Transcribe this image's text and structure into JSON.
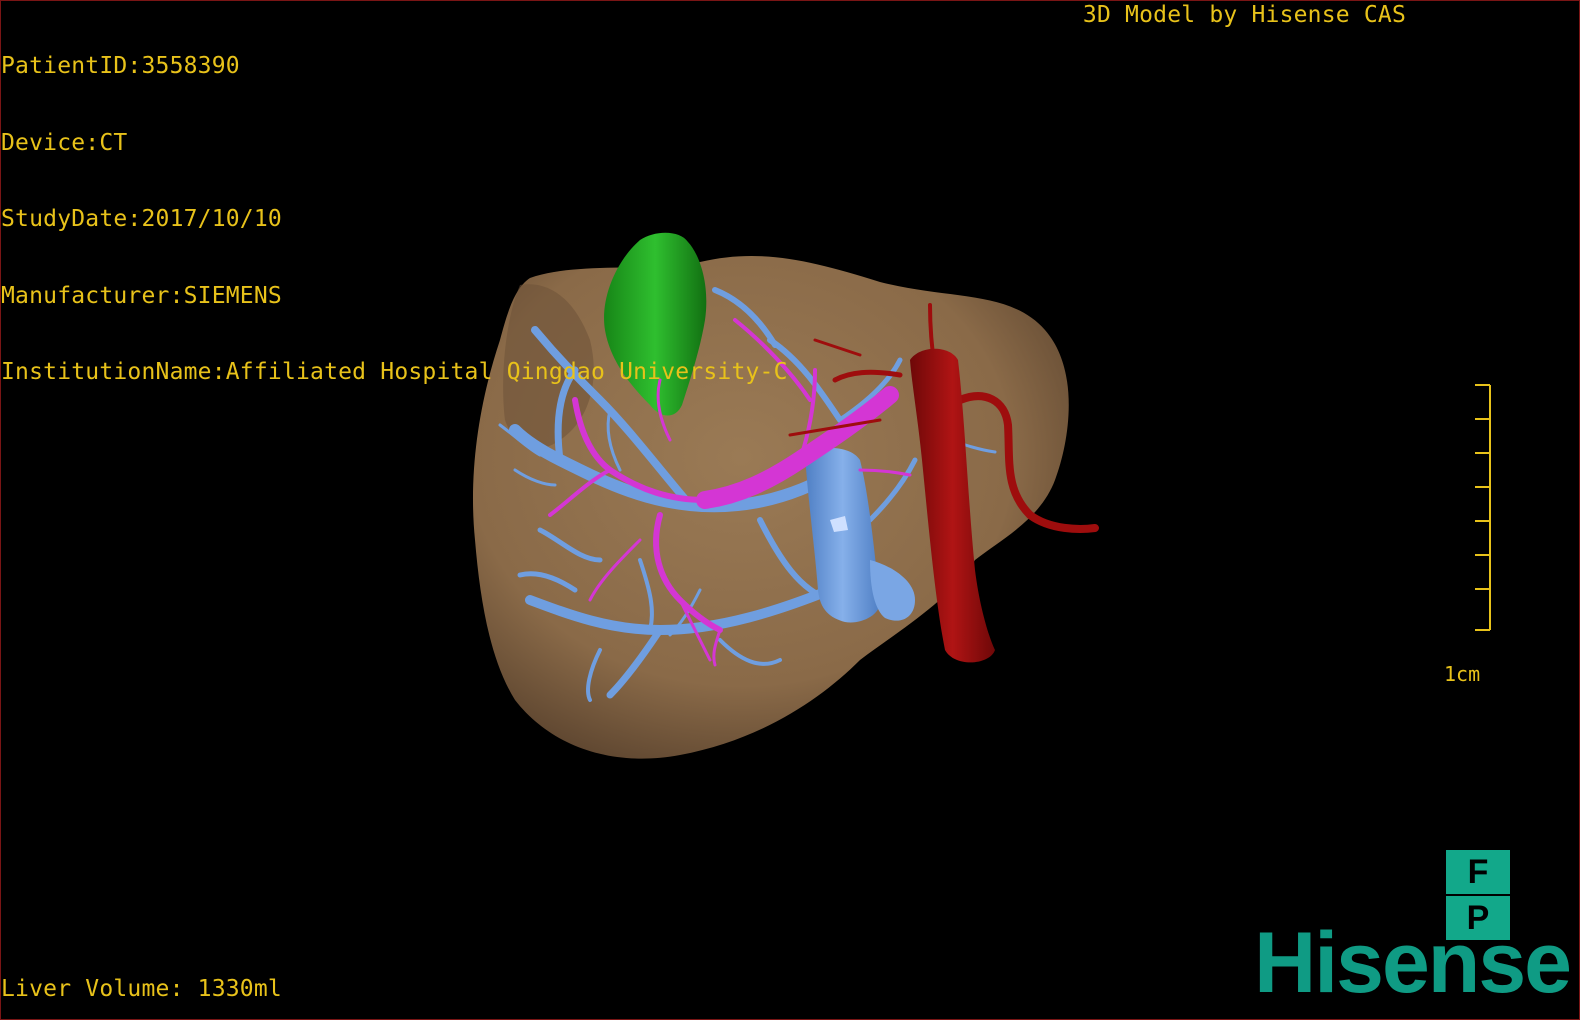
{
  "header": {
    "patient_id": "PatientID:3558390",
    "device": "Device:CT",
    "study_date": "StudyDate:2017/10/10",
    "manufacturer": "Manufacturer:SIEMENS",
    "institution": "InstitutionName:Affiliated Hospital Qingdao University-C",
    "title": "3D Model by Hisense CAS"
  },
  "footer": {
    "liver_volume": "Liver Volume: 1330ml"
  },
  "scale_bar": {
    "label": "1cm"
  },
  "orientation": {
    "top": "F",
    "bottom": "P"
  },
  "brand": {
    "logo_text": "Hisense"
  },
  "colors": {
    "text": "#e8c21a",
    "liver": "#8a6a48",
    "portal_vein": "#6f9ee0",
    "hepatic_artery": "#d436d4",
    "ivc_aorta": "#9e0d0d",
    "gallbladder": "#1fa01f",
    "brand": "#0f9b84"
  }
}
